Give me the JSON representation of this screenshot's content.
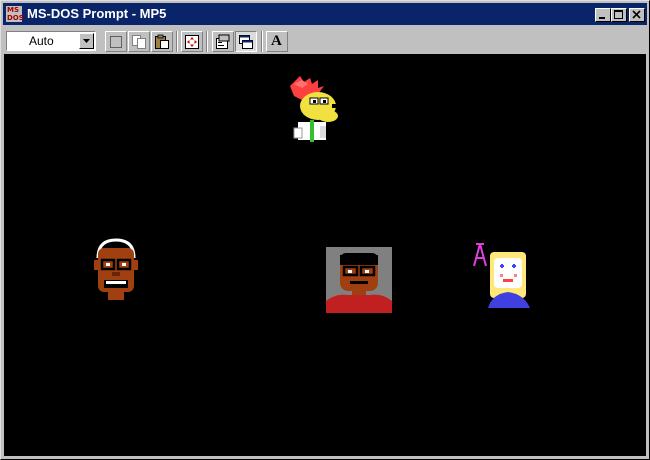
{
  "window": {
    "title": "MS-DOS Prompt - MP5",
    "icon_text": "MS DOS"
  },
  "toolbar": {
    "font_size_value": "Auto",
    "font_button_label": "A"
  },
  "icons": {
    "app": "msdos-icon",
    "minimize": "minimize-icon",
    "maximize": "maximize-icon",
    "close": "close-icon",
    "mark": "mark-icon",
    "copy": "copy-icon",
    "paste": "paste-icon",
    "fullscreen": "full-screen-icon",
    "properties": "properties-icon",
    "background": "background-icon",
    "font": "font-icon"
  },
  "screen": {
    "background": "#000000",
    "characters": [
      "rooster-character",
      "man-with-glasses-character",
      "boy-portrait-character",
      "blonde-girl-character"
    ]
  },
  "colors": {
    "titlebar": "#0a246a",
    "chrome": "#c0c0c0"
  }
}
